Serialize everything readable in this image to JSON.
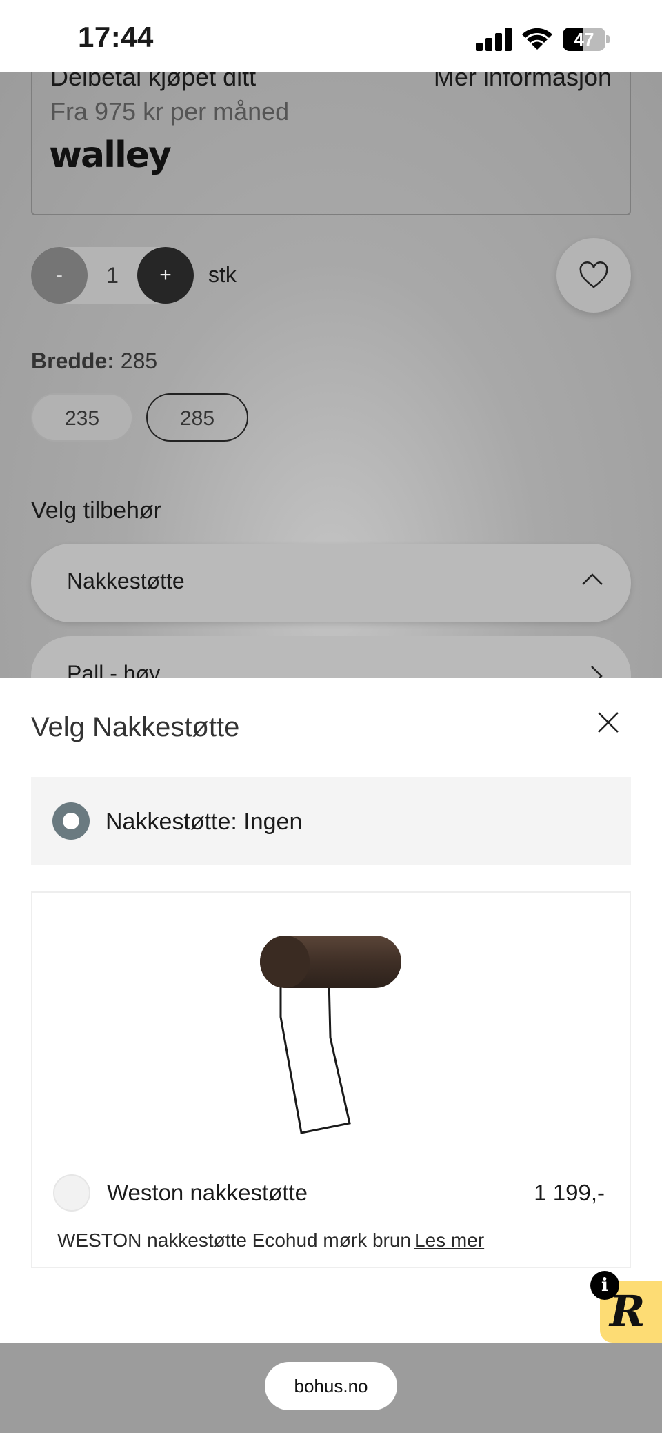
{
  "status_bar": {
    "time": "17:44",
    "battery": "47",
    "battery_level": 0.47
  },
  "walley": {
    "title": "Delbetal kjøpet ditt",
    "more_info": "Mer informasjon",
    "price_text": "Fra 975 kr per måned",
    "logo": "walley"
  },
  "quantity": {
    "minus": "-",
    "value": "1",
    "plus": "+",
    "unit": "stk"
  },
  "width": {
    "label": "Bredde:",
    "selected": "285",
    "options": [
      "235",
      "285"
    ]
  },
  "accessories": {
    "heading": "Velg tilbehør",
    "items": [
      {
        "label": "Nakkestøtte",
        "state": "expanded"
      },
      {
        "label": "Pall - høy",
        "state": "collapsed"
      }
    ]
  },
  "sheet": {
    "title": "Velg Nakkestøtte",
    "options": [
      {
        "label": "Nakkestøtte: Ingen",
        "selected": true
      },
      {
        "name": "Weston nakkestøtte",
        "price": "1 199,-",
        "description": "WESTON nakkestøtte Ecohud mørk brun",
        "link": "Les mer",
        "selected": false
      }
    ]
  },
  "badge": {
    "info": "i",
    "letter": "R"
  },
  "browser": {
    "url": "bohus.no"
  }
}
